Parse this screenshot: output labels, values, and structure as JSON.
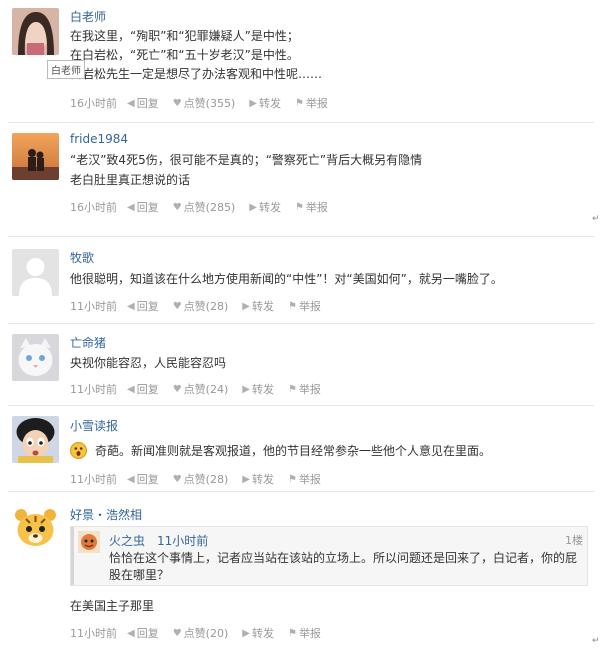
{
  "comments": [
    {
      "username": "白老师",
      "lines": [
        "在我这里，“殉职”和“犯罪嫌疑人”是中性；",
        "在白岩松，“死亡”和“五十岁老汉”是中性。",
        "白岩松先生一定是想尽了办法客观和中性呢……"
      ],
      "tooltip": "白老师",
      "time": "16小时前",
      "reply": "回复",
      "like": "点赞(355)",
      "forward": "转发",
      "report": "举报"
    },
    {
      "username": "fride1984",
      "lines": [
        "“老汉”致4死5伤，很可能不是真的；“警察死亡”背后大概另有隐情",
        "老白肚里真正想说的话"
      ],
      "time": "16小时前",
      "reply": "回复",
      "like": "点赞(285)",
      "forward": "转发",
      "report": "举报"
    },
    {
      "username": "牧歌",
      "lines": [
        "他很聪明，知道该在什么地方使用新闻的“中性”！对“美国如何”，就另一嘴脸了。"
      ],
      "time": "11小时前",
      "reply": "回复",
      "like": "点赞(28)",
      "forward": "转发",
      "report": "举报"
    },
    {
      "username": "亡命猪",
      "lines": [
        "央视你能容忍，人民能容忍吗"
      ],
      "time": "11小时前",
      "reply": "回复",
      "like": "点赞(24)",
      "forward": "转发",
      "report": "举报"
    },
    {
      "username": "小雪读报",
      "lines": [
        "奇葩。新闻准则就是客观报道，他的节目经常参杂一些他个人意见在里面。"
      ],
      "time": "11小时前",
      "reply": "回复",
      "like": "点赞(28)",
      "forward": "转发",
      "report": "举报"
    },
    {
      "username": "好景・浩然相",
      "quote": {
        "username": "火之虫",
        "time": "11小时前",
        "floor": "1楼",
        "lines": [
          "恰恰在这个事情上，记者应当站在该站的立场上。所以问题还是回来了，白记者，你的屁",
          "股在哪里？"
        ]
      },
      "lines": [
        "在美国主子那里"
      ],
      "time": "11小时前",
      "reply": "回复",
      "like": "点赞(20)",
      "forward": "转发",
      "report": "举报"
    }
  ],
  "icons": {
    "reply": "reply-arrow-icon",
    "like": "heart-icon",
    "forward": "forward-arrow-icon",
    "report": "flag-icon",
    "emoji": "surprised-emoji-icon"
  },
  "colors": {
    "username": "#336699",
    "body_text": "#333333",
    "meta_text": "#999999",
    "divider": "#e6e6e6"
  }
}
